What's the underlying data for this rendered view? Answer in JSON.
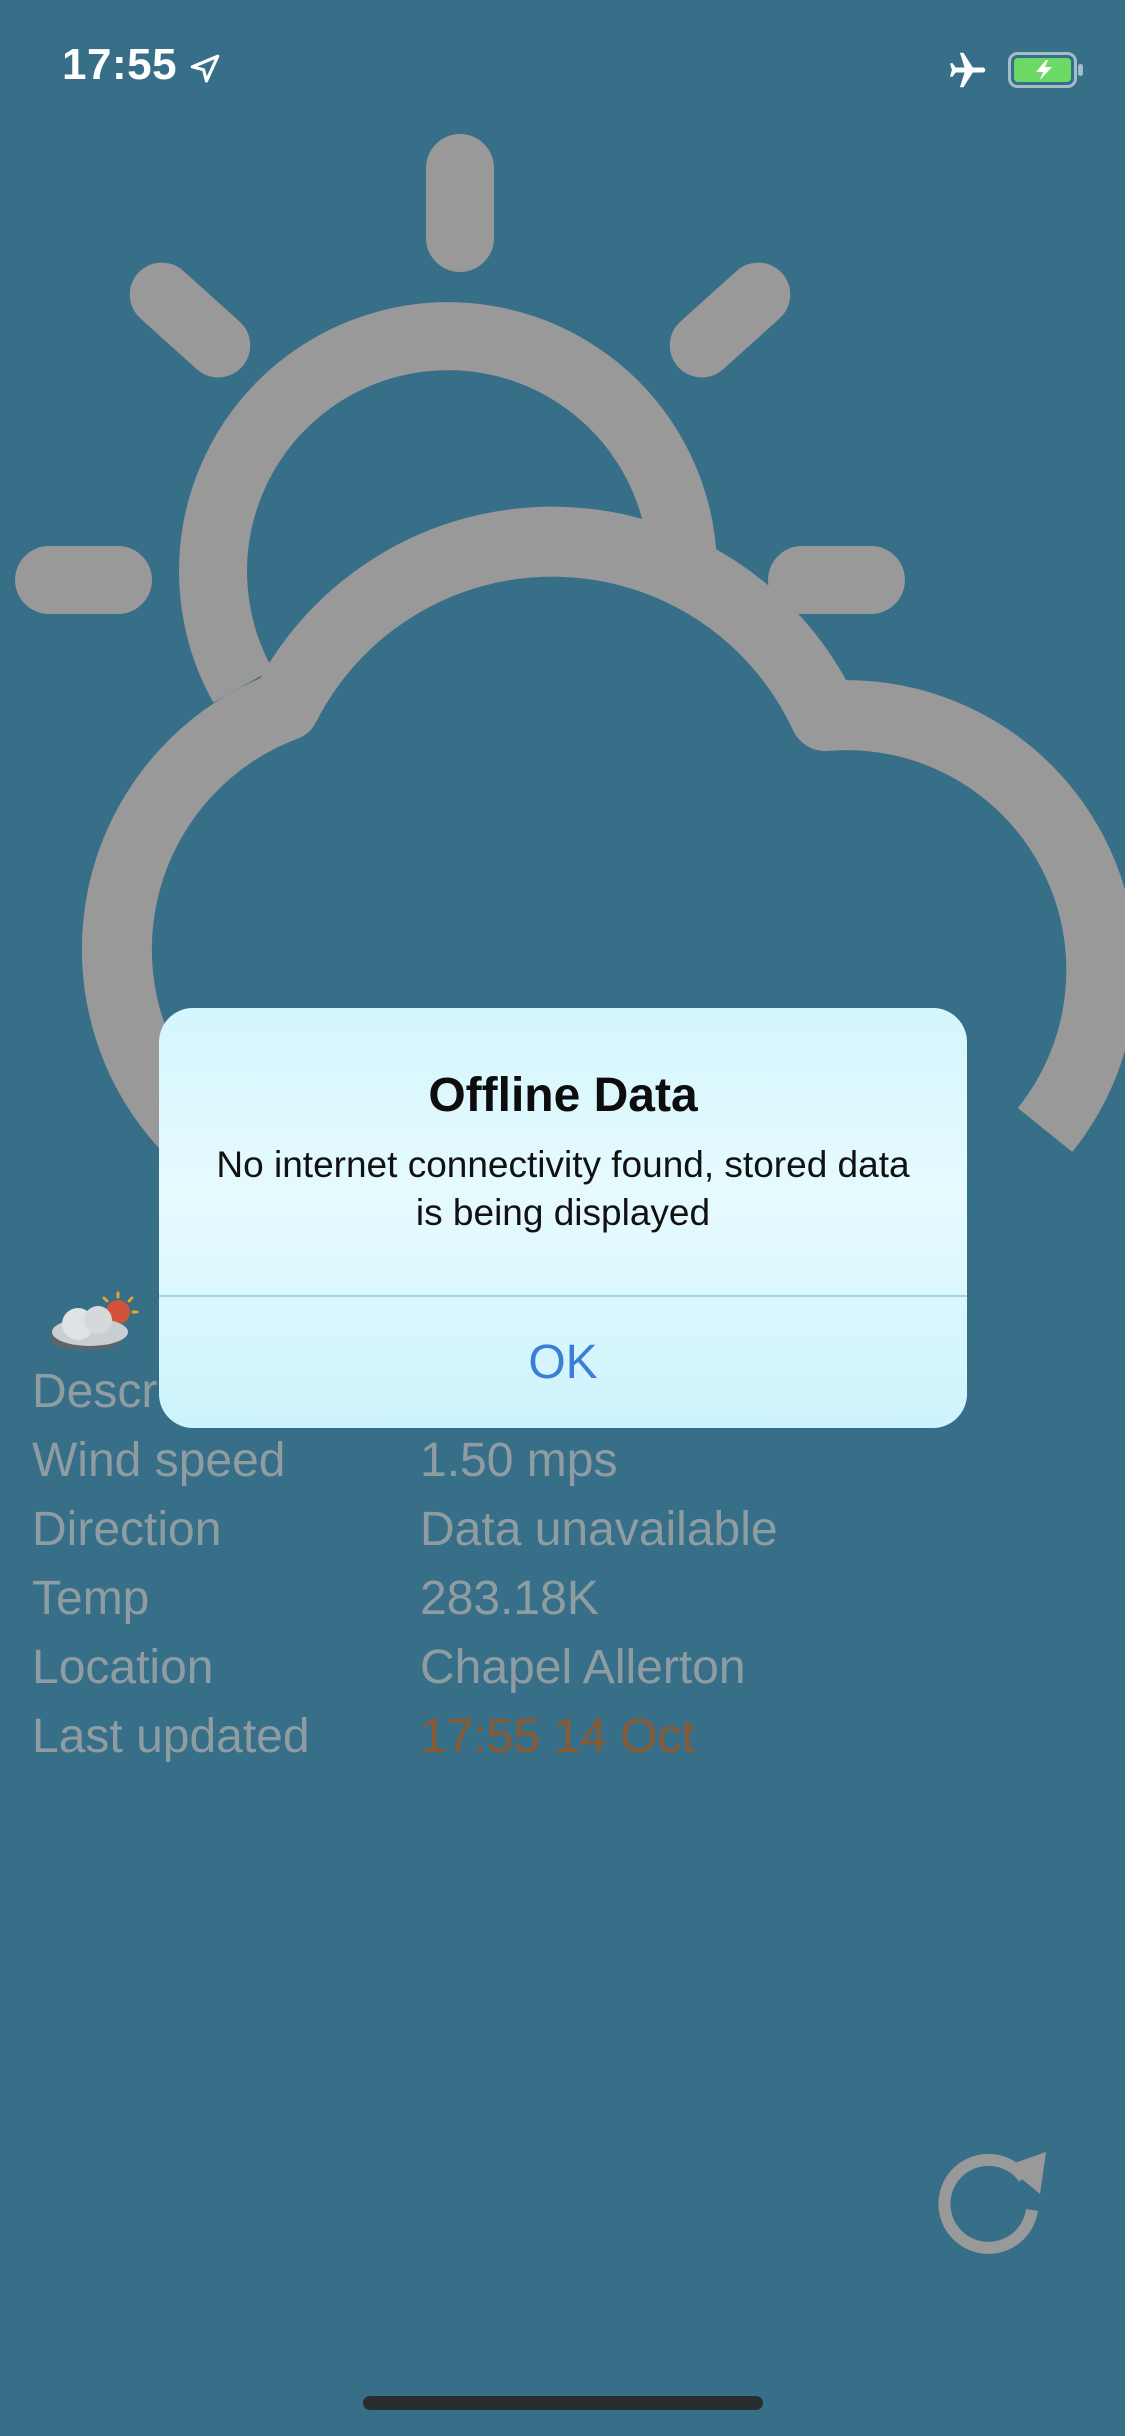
{
  "status_bar": {
    "time": "17:55"
  },
  "details": {
    "rows": [
      {
        "label": "Descr",
        "value": ""
      },
      {
        "label": "Wind speed",
        "value": "1.50 mps"
      },
      {
        "label": "Direction",
        "value": "Data unavailable"
      },
      {
        "label": "Temp",
        "value": "283.18K"
      },
      {
        "label": "Location",
        "value": "Chapel Allerton"
      },
      {
        "label": "Last updated",
        "value": "17:55 14 Oct"
      }
    ]
  },
  "alert": {
    "title": "Offline Data",
    "message": "No internet connectivity found, stored data is being displayed",
    "ok_label": "OK"
  },
  "icons": {
    "hero": "partly-cloudy-icon",
    "small": "partly-cloudy-small-icon",
    "refresh": "refresh-icon"
  },
  "colors": {
    "background": "#376f88",
    "hero_icon": "#999999",
    "detail_text": "#8f9da3",
    "last_updated": "#8a5a33",
    "alert_button": "#3a7ed8"
  }
}
